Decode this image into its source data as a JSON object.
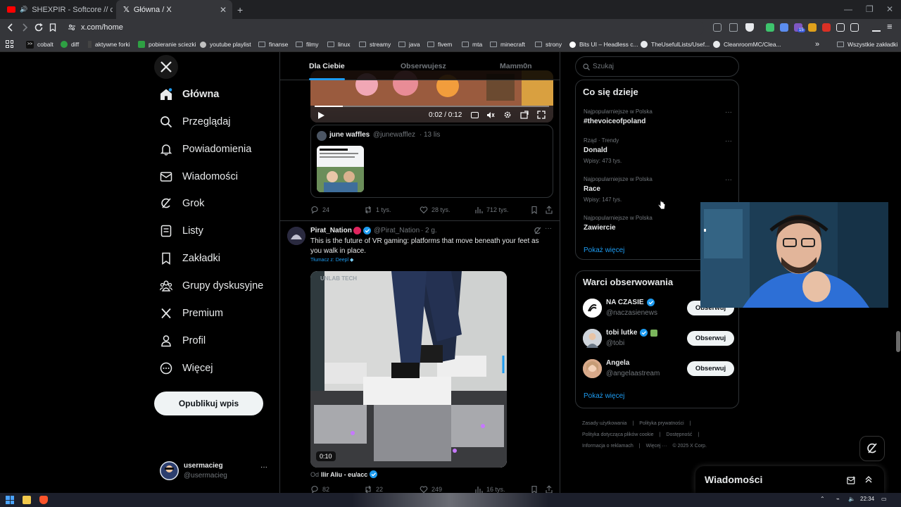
{
  "browser": {
    "tabs": [
      {
        "label": "SHEXPIR - Softcore // chillphonk",
        "active": false
      },
      {
        "label": "Główna / X",
        "active": true
      }
    ],
    "new_tab": "+",
    "url": "x.com/home",
    "bookmarks": [
      "cobalt",
      "diff",
      "aktywne forki",
      "pobieranie sciezki",
      "youtube playlist",
      "finanse",
      "filmy",
      "linux",
      "streamy",
      "java",
      "fivem",
      "mta",
      "minecraft",
      "strony",
      "Bits UI – Headless c...",
      "TheUsefulLists/Usef...",
      "CleanroomMC/Clea..."
    ],
    "bookmarks_more": "»",
    "all_bookmarks": "Wszystkie zakładki",
    "ext_badge": "15"
  },
  "leftnav": {
    "items": [
      {
        "label": "Główna",
        "icon": "home-icon",
        "bold": true
      },
      {
        "label": "Przeglądaj",
        "icon": "search-icon"
      },
      {
        "label": "Powiadomienia",
        "icon": "bell-icon"
      },
      {
        "label": "Wiadomości",
        "icon": "envelope-icon"
      },
      {
        "label": "Grok",
        "icon": "grok-icon"
      },
      {
        "label": "Listy",
        "icon": "list-icon"
      },
      {
        "label": "Zakładki",
        "icon": "bookmark-icon"
      },
      {
        "label": "Grupy dyskusyjne",
        "icon": "people-icon"
      },
      {
        "label": "Premium",
        "icon": "x-logo-icon"
      },
      {
        "label": "Profil",
        "icon": "person-icon"
      },
      {
        "label": "Więcej",
        "icon": "more-circle-icon"
      }
    ],
    "publish": "Opublikuj wpis",
    "account": {
      "name": "usermacieg",
      "handle": "@usermacieg",
      "more": "···"
    }
  },
  "feed": {
    "tabs": [
      "Dla Ciebie",
      "Obserwujesz",
      "Mamm0n"
    ],
    "tweet1": {
      "video_time": "0:02 / 0:12",
      "quote": {
        "name": "june waffles",
        "handle": "@junewafflez",
        "date": "13 lis"
      },
      "actions": {
        "replies": "24",
        "reposts": "1 tys.",
        "likes": "28 tys.",
        "views": "712 tys."
      }
    },
    "tweet2": {
      "name": "Pirat_Nation",
      "handle": "@Pirat_Nation",
      "time": "2 g.",
      "text": "This is the future of VR gaming: platforms that move beneath your feet as you walk in place.",
      "translate": "Tłumacz z: Deepl",
      "video_duration": "0:10",
      "video_watermark": "UNLAB TECH",
      "from_prefix": "Od",
      "from": "Ilir Aliu - eu/acc",
      "actions": {
        "replies": "82",
        "reposts": "22",
        "likes": "249",
        "views": "16 tys."
      }
    }
  },
  "sidebar": {
    "search_placeholder": "Szukaj",
    "trends_title": "Co się dzieje",
    "trends": [
      {
        "meta": "Najpopularniejsze w Polska",
        "name": "#thevoiceofpoland",
        "count": ""
      },
      {
        "meta": "Rząd · Trendy",
        "name": "Donald",
        "count": "Wpisy: 473 tys."
      },
      {
        "meta": "Najpopularniejsze w Polska",
        "name": "Race",
        "count": "Wpisy: 147 tys."
      },
      {
        "meta": "Najpopularniejsze w Polska",
        "name": "Zawiercie",
        "count": ""
      }
    ],
    "trends_more": "Pokaż więcej",
    "who_title": "Warci obserwowania",
    "who": [
      {
        "name": "NA CZASIE",
        "handle": "@naczasienews",
        "button": "Obserwuj"
      },
      {
        "name": "tobi lutke",
        "handle": "@tobi",
        "button": "Obserwuj"
      },
      {
        "name": "Angela",
        "handle": "@angelaastream",
        "button": "Obserwuj"
      }
    ],
    "who_more": "Pokaż więcej",
    "footer": [
      "Zasady użytkowania",
      "|",
      "Polityka prywatności",
      "|",
      "Polityka dotycząca plików cookie",
      "|",
      "Dostępność",
      "|",
      "Informacja o reklamach",
      "|",
      "Więcej ···",
      "© 2025 X Corp."
    ]
  },
  "messages_drawer": {
    "title": "Wiadomości"
  },
  "taskbar": {
    "time": "22:34"
  },
  "colors": {
    "accent": "#1d9bf0",
    "background": "#000000",
    "border": "#2f3336",
    "muted": "#71767b",
    "text": "#e7e9ea"
  }
}
